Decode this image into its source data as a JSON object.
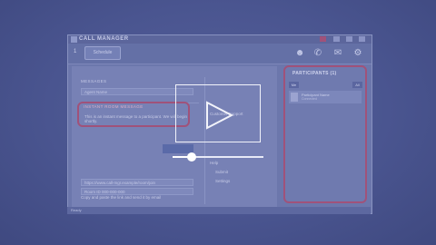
{
  "window": {
    "title": "CALL MANAGER"
  },
  "toolbar": {
    "number": "1",
    "pill_label": "Schedule"
  },
  "content": {
    "section1": "MESSAGES",
    "agent_field": "Agent Name",
    "instant_label": "INSTANT ROOM MESSAGE",
    "instant_text": "This is an instant message to a participant. We will begin shortly.",
    "customer_support": "Customer Support",
    "help_label": "Help",
    "help_items": [
      "Submit",
      "Settings"
    ],
    "bottom_hint": "Copy and paste the link and send it by email",
    "link_field": "https://www.call-mgr.example/room/join",
    "link_field2": "Room ID 000-000-000"
  },
  "participants": {
    "title": "PARTICIPANTS (1)",
    "toggle_left": "Me",
    "toggle_right": "All",
    "person_name": "Participant Name",
    "person_status": "Connected"
  },
  "statusbar": {
    "text": "Ready"
  },
  "video": {
    "progress_fraction": 0.21
  },
  "colors": {
    "overlay": "#4a5590",
    "highlight": "#a0527a",
    "player_white": "#f2f3fa"
  },
  "icons": [
    "user-icon",
    "phone-icon",
    "chat-icon",
    "settings-icon",
    "play-icon"
  ]
}
